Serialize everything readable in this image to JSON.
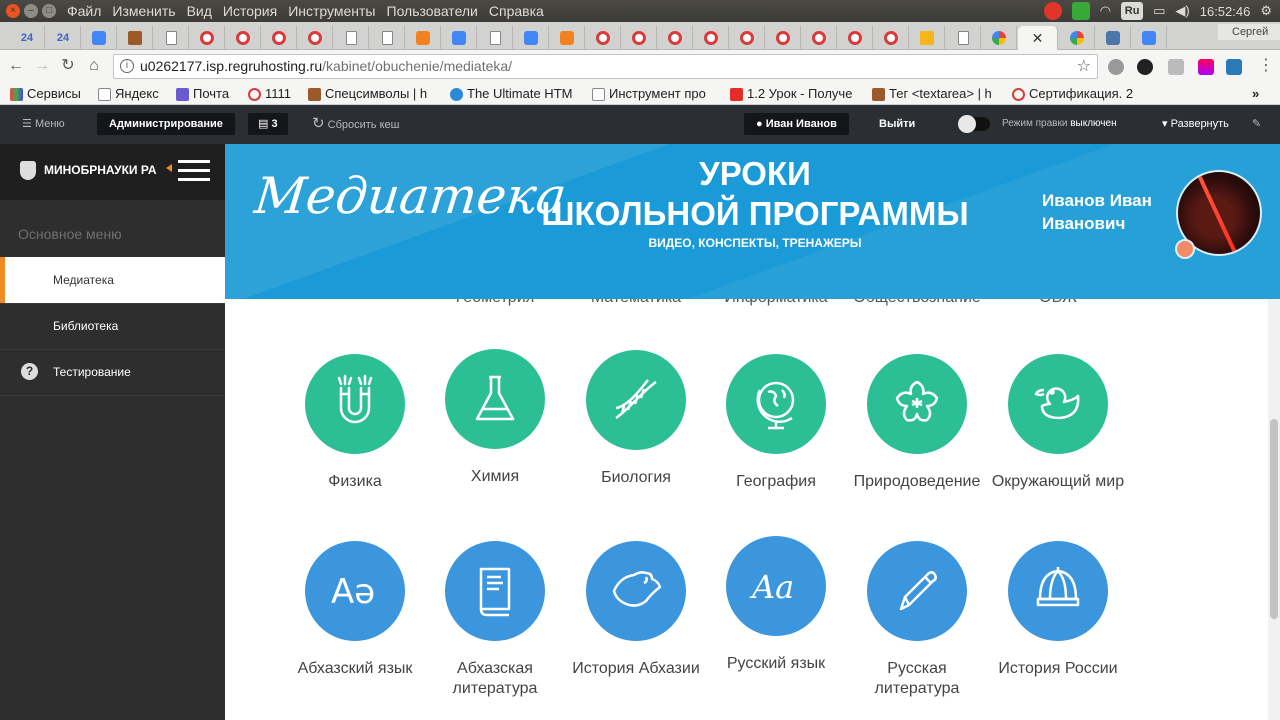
{
  "os": {
    "menu": [
      "Файл",
      "Изменить",
      "Вид",
      "История",
      "Инструменты",
      "Пользователи",
      "Справка"
    ],
    "lang": "Ru",
    "time": "16:52:46"
  },
  "browser": {
    "tabs": [
      "24",
      "24"
    ],
    "profile": "Сергей",
    "url_host": "u0262177.isp.regruhosting.ru",
    "url_path": "/kabinet/obuchenie/mediateka/",
    "bookmarks": [
      "Сервисы",
      "Яндекс",
      "Почта",
      "1111",
      "Спецсимволы | h",
      "The Ultimate HTM",
      "Инструмент про",
      "1.2 Урок - Получе",
      "Тег <textarea> | h",
      "Сертификация. 2"
    ]
  },
  "admin_bar": {
    "menu": "Меню",
    "admin": "Администрирование",
    "count": "3",
    "reset_cache": "Сбросить кеш",
    "user": "Иван Иванов",
    "logout": "Выйти",
    "edit_mode": "Режим правки",
    "edit_state": "выключен",
    "expand": "Развернуть"
  },
  "sidebar": {
    "title": "МИНОБРНАУКИ РА",
    "section": "Основное меню",
    "items": [
      {
        "label": "Медиатека"
      },
      {
        "label": "Библиотека"
      },
      {
        "label": "Тестирование"
      }
    ]
  },
  "banner": {
    "brand": "Медиатека",
    "title_line1": "УРОКИ",
    "title_line2": "ШКОЛЬНОЙ ПРОГРАММЫ",
    "subtitle": "ВИДЕО, КОНСПЕКТЫ, ТРЕНАЖЕРЫ",
    "user_line1": "Иванов Иван",
    "user_line2": "Иванович"
  },
  "clipped_row": [
    "",
    "Геометрия",
    "Математика",
    "Информатика",
    "Обществознание",
    "ОБЖ"
  ],
  "subjects_row1": [
    {
      "label": "Физика",
      "icon": "magnet-icon"
    },
    {
      "label": "Химия",
      "icon": "flask-icon"
    },
    {
      "label": "Биология",
      "icon": "dna-icon"
    },
    {
      "label": "География",
      "icon": "globe-icon"
    },
    {
      "label": "Природоведение",
      "icon": "flower-icon"
    },
    {
      "label": "Окружающий мир",
      "icon": "duck-icon"
    }
  ],
  "subjects_row2": [
    {
      "label": "Абхазский язык",
      "icon": "letters-icon"
    },
    {
      "label": "Абхазская литература",
      "icon": "book-icon"
    },
    {
      "label": "История Абхазии",
      "icon": "map-icon"
    },
    {
      "label": "Русский язык",
      "icon": "script-letters-icon"
    },
    {
      "label": "Русская литература",
      "icon": "pen-icon"
    },
    {
      "label": "История России",
      "icon": "helmet-icon"
    }
  ],
  "colors": {
    "green": "#2cbf96",
    "blue": "#3b96de",
    "banner": "#1a9ad6",
    "accent": "#f08a24"
  }
}
